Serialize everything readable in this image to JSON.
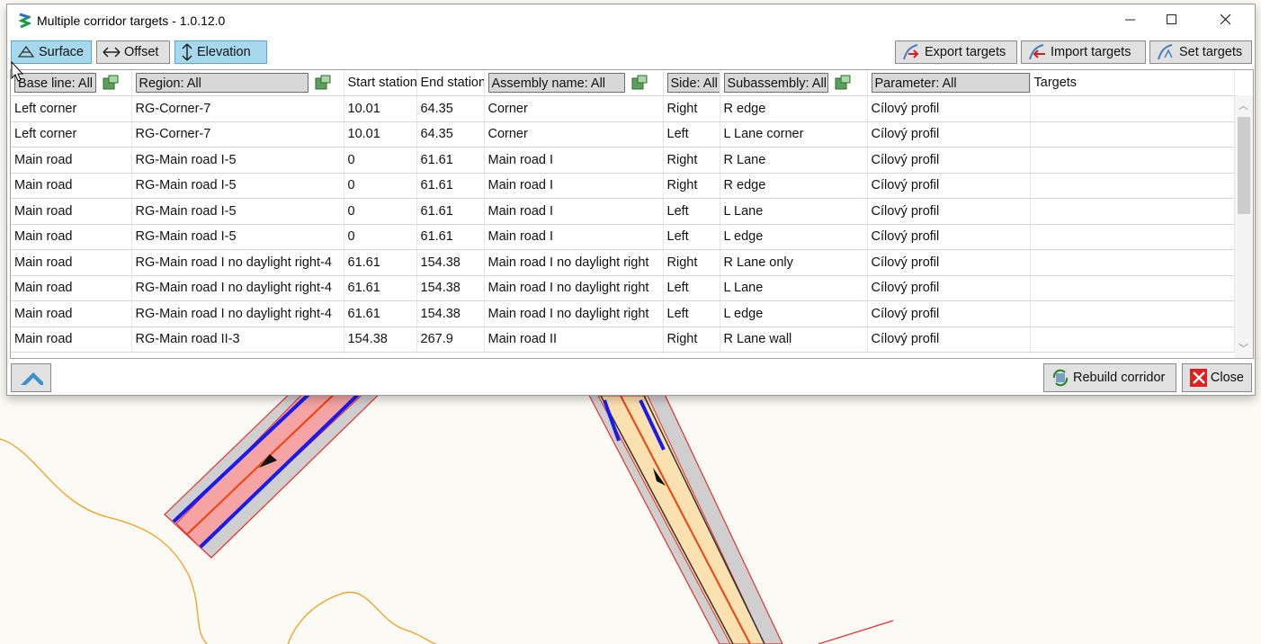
{
  "window": {
    "title": "Multiple corridor targets - 1.0.12.0"
  },
  "toolbar": {
    "surface_label": "Surface",
    "offset_label": "Offset",
    "elevation_label": "Elevation",
    "export_label": "Export targets",
    "import_label": "Import targets",
    "set_label": "Set targets"
  },
  "columns": {
    "baseline": "Base line: All",
    "region": "Region: All",
    "start": "Start station",
    "end": "End station",
    "assembly": "Assembly name: All",
    "side": "Side: All",
    "subassembly": "Subassembly: All",
    "parameter": "Parameter: All",
    "targets": "Targets"
  },
  "rows": [
    [
      "Left corner",
      "RG-Corner-7",
      "10.01",
      "64.35",
      "Corner",
      "Right",
      "R edge",
      "Cílový profil",
      ""
    ],
    [
      "Left corner",
      "RG-Corner-7",
      "10.01",
      "64.35",
      "Corner",
      "Left",
      "L Lane corner",
      "Cílový profil",
      ""
    ],
    [
      "Main road",
      "RG-Main road I-5",
      "0",
      "61.61",
      "Main road I",
      "Right",
      "R Lane",
      "Cílový profil",
      ""
    ],
    [
      "Main road",
      "RG-Main road I-5",
      "0",
      "61.61",
      "Main road I",
      "Right",
      "R edge",
      "Cílový profil",
      ""
    ],
    [
      "Main road",
      "RG-Main road I-5",
      "0",
      "61.61",
      "Main road I",
      "Left",
      "L Lane",
      "Cílový profil",
      ""
    ],
    [
      "Main road",
      "RG-Main road I-5",
      "0",
      "61.61",
      "Main road I",
      "Left",
      "L edge",
      "Cílový profil",
      ""
    ],
    [
      "Main road",
      "RG-Main road I no daylight right-4",
      "61.61",
      "154.38",
      "Main road I no daylight right",
      "Right",
      "R Lane only",
      "Cílový profil",
      ""
    ],
    [
      "Main road",
      "RG-Main road I no daylight right-4",
      "61.61",
      "154.38",
      "Main road I no daylight right",
      "Left",
      "L Lane",
      "Cílový profil",
      ""
    ],
    [
      "Main road",
      "RG-Main road I no daylight right-4",
      "61.61",
      "154.38",
      "Main road I no daylight right",
      "Left",
      "L edge",
      "Cílový profil",
      ""
    ],
    [
      "Main road",
      "RG-Main road II-3",
      "154.38",
      "267.9",
      "Main road II",
      "Right",
      "R Lane wall",
      "Cílový profil",
      ""
    ]
  ],
  "bottom": {
    "rebuild_label": "Rebuild corridor",
    "close_label": "Close"
  },
  "icons": {
    "app": "app-logo-icon",
    "minimize": "minimize-icon",
    "maximize": "maximize-icon",
    "close": "close-icon",
    "filter": "filter-clear-icon",
    "collapse": "chevron-up-icon"
  }
}
